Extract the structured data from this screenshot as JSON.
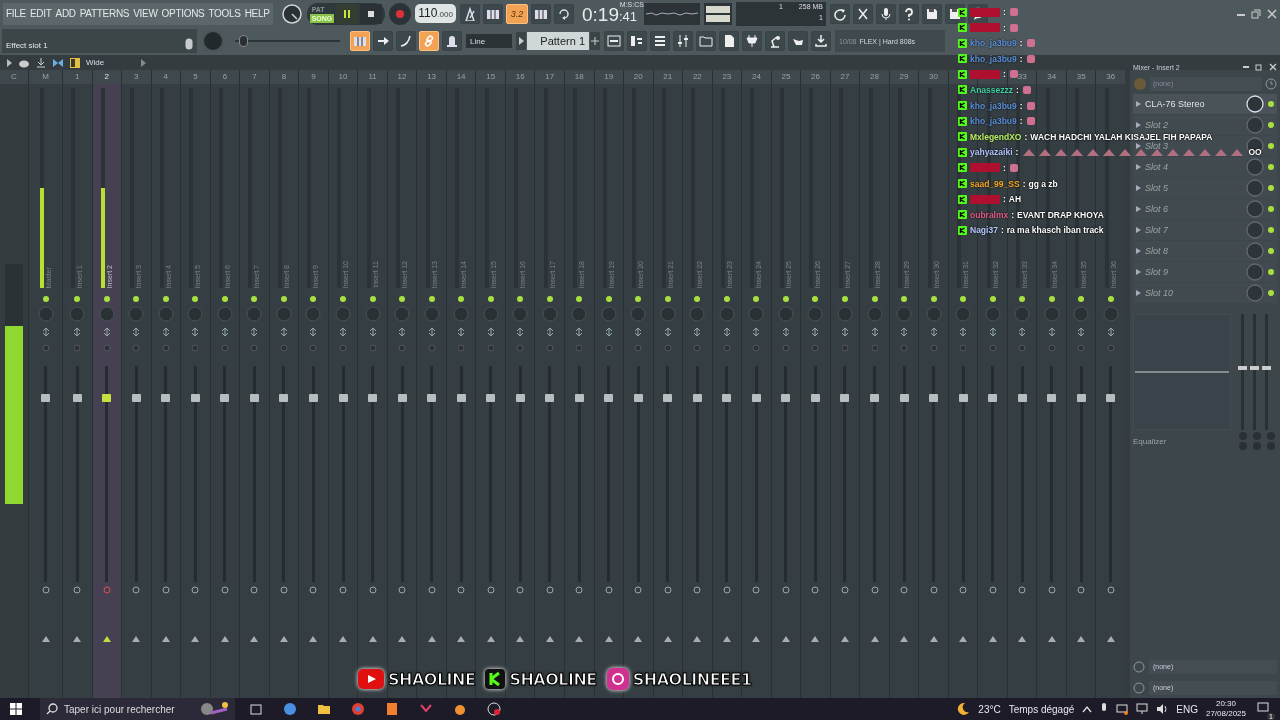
{
  "menu": [
    "FILE",
    "EDIT",
    "ADD",
    "PATTERNS",
    "VIEW",
    "OPTIONS",
    "TOOLS",
    "HELP"
  ],
  "hint": "Effect slot 1",
  "transport": {
    "modes": [
      {
        "label": "PAT",
        "selected": false
      },
      {
        "label": "SONG",
        "selected": true
      }
    ],
    "playing": true
  },
  "tempo": {
    "value": "110",
    "fraction": ".000"
  },
  "top_toggles": [
    {
      "kind": "metronome",
      "on": false
    },
    {
      "kind": "steps",
      "on": false
    },
    {
      "kind": "count",
      "label": "3.2",
      "on": true
    },
    {
      "kind": "keys",
      "on": false
    },
    {
      "kind": "loop",
      "on": false
    }
  ],
  "time": {
    "value": "0:19",
    "seconds": ":41",
    "unit": "M:S:CS"
  },
  "cpu": {
    "cpu": "1",
    "memory": "258 MB",
    "polyphony": "1"
  },
  "tool_toggles": [
    {
      "kind": "typing",
      "on": true
    },
    {
      "kind": "arrow",
      "on": false
    },
    {
      "kind": "curve",
      "on": false
    },
    {
      "kind": "link",
      "on": true
    },
    {
      "kind": "bell",
      "on": false
    }
  ],
  "pitch_slider": {
    "level": 0.08
  },
  "snap": "Line",
  "pattern": "Pattern 1",
  "browser": {
    "counter": "10/08",
    "text": "FLEX | Hard 808s"
  },
  "mixer_toolbar": {
    "label": "Wide"
  },
  "mixer": {
    "current": "C",
    "main_meter": {
      "level": 0.74
    },
    "strips": [
      {
        "number": "M",
        "name": "Master",
        "selected": false,
        "meter": {
          "level": 0.5
        },
        "fader": {
          "level": 0.85
        }
      },
      {
        "number": "1",
        "name": "Insert 1",
        "selected": false,
        "meter": {
          "level": 0
        },
        "fader": {
          "level": 0.85
        }
      },
      {
        "number": "2",
        "name": "Insert 2",
        "selected": true,
        "meter": {
          "level": 0.5
        },
        "fader": {
          "level": 0.85
        }
      },
      {
        "number": "3",
        "name": "Insert 3",
        "selected": false,
        "meter": {
          "level": 0
        },
        "fader": {
          "level": 0.85
        }
      },
      {
        "number": "4",
        "name": "Insert 4",
        "selected": false,
        "meter": {
          "level": 0
        },
        "fader": {
          "level": 0.85
        }
      },
      {
        "number": "5",
        "name": "Insert 5",
        "selected": false,
        "meter": {
          "level": 0
        },
        "fader": {
          "level": 0.85
        }
      },
      {
        "number": "6",
        "name": "Insert 6",
        "selected": false,
        "meter": {
          "level": 0
        },
        "fader": {
          "level": 0.85
        }
      },
      {
        "number": "7",
        "name": "Insert 7",
        "selected": false,
        "meter": {
          "level": 0
        },
        "fader": {
          "level": 0.85
        }
      },
      {
        "number": "8",
        "name": "Insert 8",
        "selected": false,
        "meter": {
          "level": 0
        },
        "fader": {
          "level": 0.85
        }
      },
      {
        "number": "9",
        "name": "Insert 9",
        "selected": false,
        "meter": {
          "level": 0
        },
        "fader": {
          "level": 0.85
        }
      },
      {
        "number": "10",
        "name": "Insert 10",
        "selected": false,
        "meter": {
          "level": 0
        },
        "fader": {
          "level": 0.85
        }
      },
      {
        "number": "11",
        "name": "Insert 11",
        "selected": false,
        "meter": {
          "level": 0
        },
        "fader": {
          "level": 0.85
        }
      },
      {
        "number": "12",
        "name": "Insert 12",
        "selected": false,
        "meter": {
          "level": 0
        },
        "fader": {
          "level": 0.85
        }
      },
      {
        "number": "13",
        "name": "Insert 13",
        "selected": false,
        "meter": {
          "level": 0
        },
        "fader": {
          "level": 0.85
        }
      },
      {
        "number": "14",
        "name": "Insert 14",
        "selected": false,
        "meter": {
          "level": 0
        },
        "fader": {
          "level": 0.85
        }
      },
      {
        "number": "15",
        "name": "Insert 15",
        "selected": false,
        "meter": {
          "level": 0
        },
        "fader": {
          "level": 0.85
        }
      },
      {
        "number": "16",
        "name": "Insert 16",
        "selected": false,
        "meter": {
          "level": 0
        },
        "fader": {
          "level": 0.85
        }
      },
      {
        "number": "17",
        "name": "Insert 17",
        "selected": false,
        "meter": {
          "level": 0
        },
        "fader": {
          "level": 0.85
        }
      },
      {
        "number": "18",
        "name": "Insert 18",
        "selected": false,
        "meter": {
          "level": 0
        },
        "fader": {
          "level": 0.85
        }
      },
      {
        "number": "19",
        "name": "Insert 19",
        "selected": false,
        "meter": {
          "level": 0
        },
        "fader": {
          "level": 0.85
        }
      },
      {
        "number": "20",
        "name": "Insert 20",
        "selected": false,
        "meter": {
          "level": 0
        },
        "fader": {
          "level": 0.85
        }
      },
      {
        "number": "21",
        "name": "Insert 21",
        "selected": false,
        "meter": {
          "level": 0
        },
        "fader": {
          "level": 0.85
        }
      },
      {
        "number": "22",
        "name": "Insert 22",
        "selected": false,
        "meter": {
          "level": 0
        },
        "fader": {
          "level": 0.85
        }
      },
      {
        "number": "23",
        "name": "Insert 23",
        "selected": false,
        "meter": {
          "level": 0
        },
        "fader": {
          "level": 0.85
        }
      },
      {
        "number": "24",
        "name": "Insert 24",
        "selected": false,
        "meter": {
          "level": 0
        },
        "fader": {
          "level": 0.85
        }
      },
      {
        "number": "25",
        "name": "Insert 25",
        "selected": false,
        "meter": {
          "level": 0
        },
        "fader": {
          "level": 0.85
        }
      },
      {
        "number": "26",
        "name": "Insert 26",
        "selected": false,
        "meter": {
          "level": 0
        },
        "fader": {
          "level": 0.85
        }
      },
      {
        "number": "27",
        "name": "Insert 27",
        "selected": false,
        "meter": {
          "level": 0
        },
        "fader": {
          "level": 0.85
        }
      },
      {
        "number": "28",
        "name": "Insert 28",
        "selected": false,
        "meter": {
          "level": 0
        },
        "fader": {
          "level": 0.85
        }
      },
      {
        "number": "29",
        "name": "Insert 29",
        "selected": false,
        "meter": {
          "level": 0
        },
        "fader": {
          "level": 0.85
        }
      },
      {
        "number": "30",
        "name": "Insert 30",
        "selected": false,
        "meter": {
          "level": 0
        },
        "fader": {
          "level": 0.85
        }
      },
      {
        "name": "Insert 31",
        "selected": false,
        "meter": {
          "level": 0
        },
        "fader": {
          "level": 0.85
        }
      },
      {
        "name": "Insert 32",
        "selected": false,
        "meter": {
          "level": 0
        },
        "fader": {
          "level": 0.85
        }
      },
      {
        "number": "33",
        "name": "Insert 33",
        "selected": false,
        "meter": {
          "level": 0
        },
        "fader": {
          "level": 0.85
        }
      },
      {
        "number": "34",
        "name": "Insert 34",
        "selected": false,
        "meter": {
          "level": 0
        },
        "fader": {
          "level": 0.85
        }
      },
      {
        "number": "35",
        "name": "Insert 35",
        "selected": false,
        "meter": {
          "level": 0
        },
        "fader": {
          "level": 0.85
        }
      },
      {
        "number": "36",
        "name": "Insert 36",
        "selected": false,
        "meter": {
          "level": 0
        },
        "fader": {
          "level": 0.85
        }
      }
    ]
  },
  "insert_panel": {
    "title": "Mixer - Insert 2",
    "preset": "(none)",
    "slots": [
      {
        "label": "CLA-76 Stereo",
        "kind": "plugin"
      },
      {
        "label": "Slot 2",
        "kind": "empty"
      },
      {
        "label": "Slot 3",
        "kind": "empty"
      },
      {
        "label": "Slot 4",
        "kind": "empty"
      },
      {
        "label": "Slot 5",
        "kind": "empty"
      },
      {
        "label": "Slot 6",
        "kind": "empty"
      },
      {
        "label": "Slot 7",
        "kind": "empty"
      },
      {
        "label": "Slot 8",
        "kind": "empty"
      },
      {
        "label": "Slot 9",
        "kind": "empty"
      },
      {
        "label": "Slot 10",
        "kind": "empty"
      }
    ],
    "eq_label": "Equalizer",
    "routing": [
      "(none)",
      "(none)"
    ]
  },
  "chat": [
    {
      "sep": ":",
      "color": "#b01030",
      "kind": "emote"
    },
    {
      "sep": ":",
      "color": "#b01030",
      "kind": "emote"
    },
    {
      "user": "kho_ja3bu9",
      "sep": ":",
      "color": "#5b8fd9",
      "kind": "emote"
    },
    {
      "user": "kho_ja3bu9",
      "sep": ":",
      "color": "#5b8fd9",
      "kind": "emote"
    },
    {
      "sep": ":",
      "color": "#b01030",
      "kind": "emote"
    },
    {
      "user": "Anassezzz",
      "sep": ":",
      "color": "#3fd0a0",
      "kind": "emote"
    },
    {
      "user": "kho_ja3bu9",
      "sep": ":",
      "color": "#5b8fd9",
      "kind": "emote"
    },
    {
      "user": "kho_ja3bu9",
      "sep": ":",
      "color": "#5b8fd9",
      "kind": "emote"
    },
    {
      "user": "MxlegendXO",
      "sep": ":",
      "color": "#b8f060",
      "kind": "text",
      "text": "WACH HADCHI YALAH KISAJEL FIH PAPAPA"
    },
    {
      "user": "yahyazaiki",
      "sep": ":",
      "color": "#b0c0ff",
      "kind": "emote_row",
      "text": "OO"
    },
    {
      "sep": ":",
      "color": "#b01030",
      "kind": "emote"
    },
    {
      "user": "saad_99_SS",
      "sep": ":",
      "color": "#f5a623",
      "kind": "text",
      "text": "gg a zb"
    },
    {
      "sep": ":",
      "color": "#b01030",
      "kind": "text",
      "text": "AH"
    },
    {
      "user": "oubralmx",
      "sep": ":",
      "color": "#e05a8a",
      "kind": "text",
      "text": "EVANT DRAP KHOYA"
    },
    {
      "user": "Nagi37",
      "sep": ":",
      "color": "#b8c8ff",
      "kind": "text",
      "text": "ra ma khasch iban track"
    }
  ],
  "banner": [
    {
      "kind": "youtube",
      "handle": "SHAOLINE"
    },
    {
      "kind": "kick",
      "handle": "SHAOLINE"
    },
    {
      "kind": "instagram",
      "handle": "SHAOLINEEE1"
    }
  ],
  "taskbar": {
    "search_placeholder": "Taper ici pour rechercher",
    "temperature": "23°C",
    "weather": "Temps dégagé",
    "language": "ENG",
    "time": "20:30",
    "date": "27/08/2025",
    "notifications": "1"
  }
}
